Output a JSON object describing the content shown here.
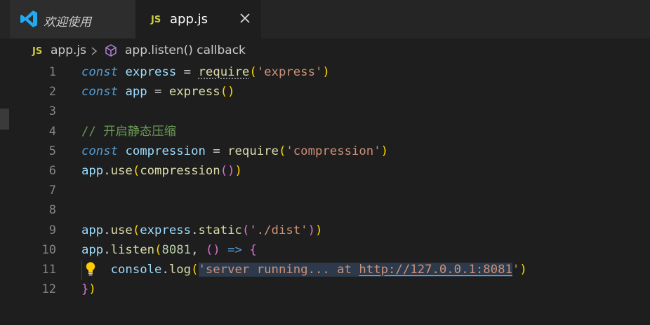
{
  "tabs": [
    {
      "label": "欢迎使用",
      "icon": "vscode-logo-icon",
      "active": false
    },
    {
      "label": "app.js",
      "icon": "js-file-icon",
      "badge": "JS",
      "active": true
    }
  ],
  "breadcrumb": {
    "badge": "JS",
    "file": "app.js",
    "symbol": "app.listen() callback"
  },
  "editor": {
    "line_numbers": [
      "1",
      "2",
      "3",
      "4",
      "5",
      "6",
      "7",
      "8",
      "9",
      "10",
      "11",
      "12"
    ],
    "code_lines": [
      [
        {
          "t": "const",
          "c": "kw"
        },
        {
          "t": " ",
          "c": "plain"
        },
        {
          "t": "express",
          "c": "var"
        },
        {
          "t": " = ",
          "c": "op"
        },
        {
          "t": "require",
          "c": "fn dotted"
        },
        {
          "t": "(",
          "c": "br1"
        },
        {
          "t": "'express'",
          "c": "str"
        },
        {
          "t": ")",
          "c": "br1"
        }
      ],
      [
        {
          "t": "const",
          "c": "kw"
        },
        {
          "t": " ",
          "c": "plain"
        },
        {
          "t": "app",
          "c": "var"
        },
        {
          "t": " = ",
          "c": "op"
        },
        {
          "t": "express",
          "c": "fn"
        },
        {
          "t": "()",
          "c": "br1"
        }
      ],
      [],
      [
        {
          "t": "// 开启静态压缩",
          "c": "cmt"
        }
      ],
      [
        {
          "t": "const",
          "c": "kw"
        },
        {
          "t": " ",
          "c": "plain"
        },
        {
          "t": "compression",
          "c": "var"
        },
        {
          "t": " = ",
          "c": "op"
        },
        {
          "t": "require",
          "c": "fn"
        },
        {
          "t": "(",
          "c": "br1"
        },
        {
          "t": "'compression'",
          "c": "str"
        },
        {
          "t": ")",
          "c": "br1"
        }
      ],
      [
        {
          "t": "app",
          "c": "var"
        },
        {
          "t": ".",
          "c": "op"
        },
        {
          "t": "use",
          "c": "fn"
        },
        {
          "t": "(",
          "c": "br1"
        },
        {
          "t": "compression",
          "c": "fn"
        },
        {
          "t": "()",
          "c": "br2"
        },
        {
          "t": ")",
          "c": "br1"
        }
      ],
      [],
      [],
      [
        {
          "t": "app",
          "c": "var"
        },
        {
          "t": ".",
          "c": "op"
        },
        {
          "t": "use",
          "c": "fn"
        },
        {
          "t": "(",
          "c": "br1"
        },
        {
          "t": "express",
          "c": "var"
        },
        {
          "t": ".",
          "c": "op"
        },
        {
          "t": "static",
          "c": "fn"
        },
        {
          "t": "(",
          "c": "br2"
        },
        {
          "t": "'./dist'",
          "c": "str"
        },
        {
          "t": ")",
          "c": "br2"
        },
        {
          "t": ")",
          "c": "br1"
        }
      ],
      [
        {
          "t": "app",
          "c": "var"
        },
        {
          "t": ".",
          "c": "op"
        },
        {
          "t": "listen",
          "c": "fn"
        },
        {
          "t": "(",
          "c": "br1"
        },
        {
          "t": "8081",
          "c": "num"
        },
        {
          "t": ", ",
          "c": "op"
        },
        {
          "t": "()",
          "c": "br2"
        },
        {
          "t": " ",
          "c": "plain"
        },
        {
          "t": "=>",
          "c": "arrow"
        },
        {
          "t": " ",
          "c": "plain"
        },
        {
          "t": "{",
          "c": "br2"
        }
      ],
      [
        {
          "t": "    ",
          "c": "plain"
        },
        {
          "t": "console",
          "c": "var"
        },
        {
          "t": ".",
          "c": "op"
        },
        {
          "t": "log",
          "c": "fn"
        },
        {
          "t": "(",
          "c": "br1"
        },
        {
          "t": "'server running... at ",
          "c": "str hl-str"
        },
        {
          "t": "http://127.0.0.1:8081",
          "c": "str hl-str link"
        },
        {
          "t": "'",
          "c": "str"
        },
        {
          "t": ")",
          "c": "br1"
        }
      ],
      [
        {
          "t": "}",
          "c": "br2"
        },
        {
          "t": ")",
          "c": "br1"
        }
      ]
    ]
  },
  "colors": {
    "tabbar_bg": "#252526",
    "editor_bg": "#1e1e1e",
    "keyword": "#569cd6",
    "string": "#ce9178",
    "function": "#dcdcaa",
    "variable": "#9cdcfe",
    "comment": "#6a9955",
    "number": "#b5cea8",
    "js_badge": "#cbcb41",
    "vscode_blue": "#23a9f2"
  },
  "icons": {
    "lightbulb": "lightbulb-icon",
    "close": "close-icon",
    "chevron": "chevron-right-icon",
    "symbol": "cube-icon"
  }
}
